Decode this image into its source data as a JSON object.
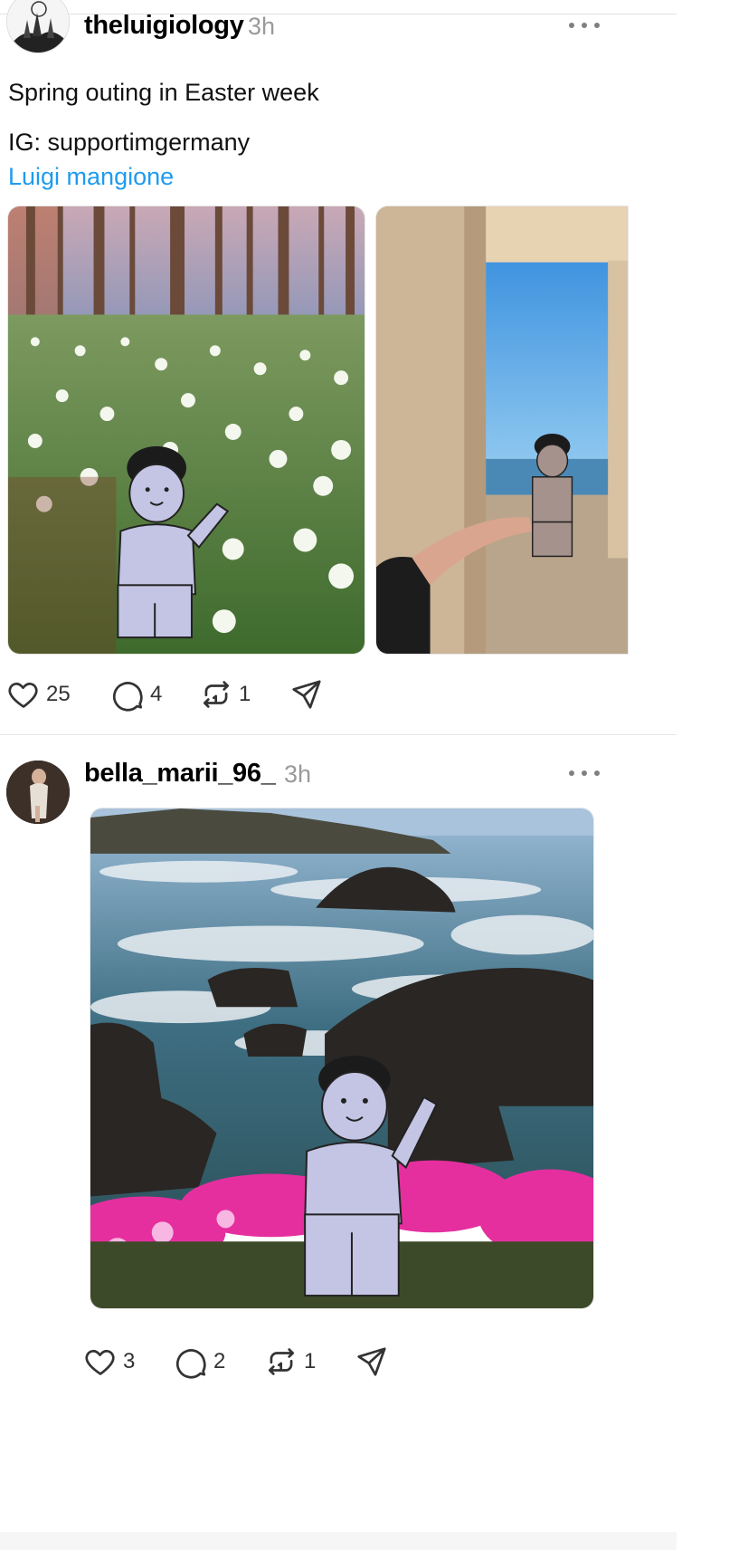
{
  "posts": [
    {
      "username": "theluigiology",
      "timestamp": "3h",
      "text_lines": [
        "Spring outing in Easter week",
        "IG: supportimgermany"
      ],
      "link": "Luigi mangione",
      "images": [
        "flower-forest-photo",
        "colonnade-sea-photo"
      ],
      "actions": {
        "likes": "25",
        "replies": "4",
        "reposts": "1"
      }
    },
    {
      "username": "bella_marii_96_",
      "timestamp": "3h",
      "images": [
        "rocky-coast-photo"
      ],
      "actions": {
        "likes": "3",
        "replies": "2",
        "reposts": "1"
      }
    }
  ],
  "icons": {
    "like": "heart-icon",
    "reply": "speech-bubble-icon",
    "repost": "repost-arrows-icon",
    "share": "send-paper-plane-icon",
    "more": "more-dots-icon"
  },
  "colors": {
    "link": "#1d9bf0",
    "timestamp": "#9a9a9a",
    "icon": "#333333"
  }
}
